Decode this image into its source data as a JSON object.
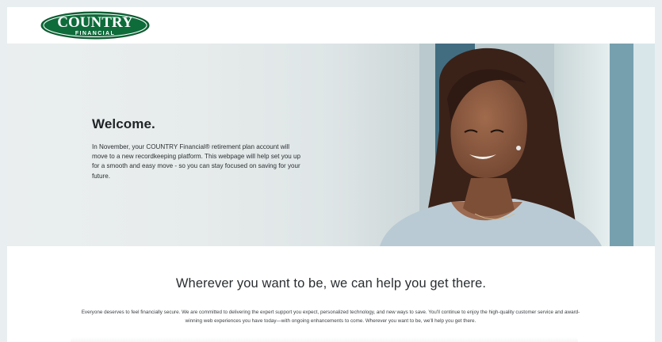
{
  "brand": {
    "logo_main": "COUNTRY",
    "logo_sub": "FINANCIAL",
    "logo_color": "#0e6b3a"
  },
  "hero": {
    "title": "Welcome.",
    "body": "In November, your COUNTRY Financial® retirement plan account will move to a new recordkeeping platform. This webpage will help set you up for a smooth and easy move - so you can stay focused on saving for your future."
  },
  "section": {
    "title": "Wherever you want to be, we can help you get there.",
    "body": "Everyone deserves to feel financially secure. We are committed to delivering the expert support you expect, personalized technology, and new ways to save. You'll continue to enjoy the high-quality customer service and award-winning web experiences you have today—with ongoing enhancements to come. Wherever you want to be, we'll help you get there."
  },
  "colors": {
    "page_bg": "#e9eef1",
    "text_dark": "#1f2326"
  }
}
